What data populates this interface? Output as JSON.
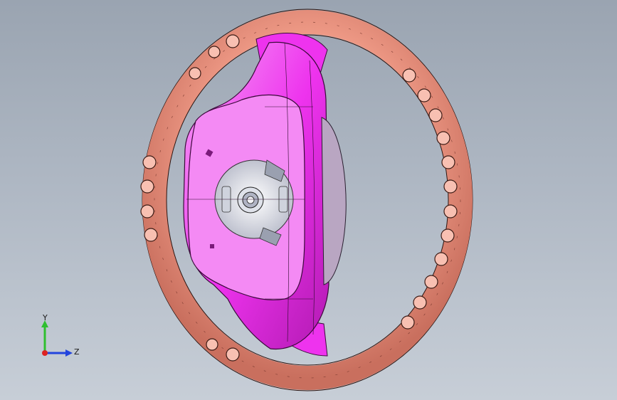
{
  "viewport": {
    "background_top": "#9aa4b1",
    "background_bottom": "#c7ced7"
  },
  "model": {
    "rim_color": "#f4a08c",
    "rim_shadow": "#c96f5e",
    "hub_color": "#ee33ee",
    "hub_face_color": "#f48af4",
    "center_color": "#d8d8e0",
    "airbag_color": "#b9a6c2"
  },
  "triad": {
    "y_label": "Y",
    "z_label": "Z",
    "y_color": "#2fbf2f",
    "z_color": "#2244dd",
    "x_color": "#dd2222"
  }
}
